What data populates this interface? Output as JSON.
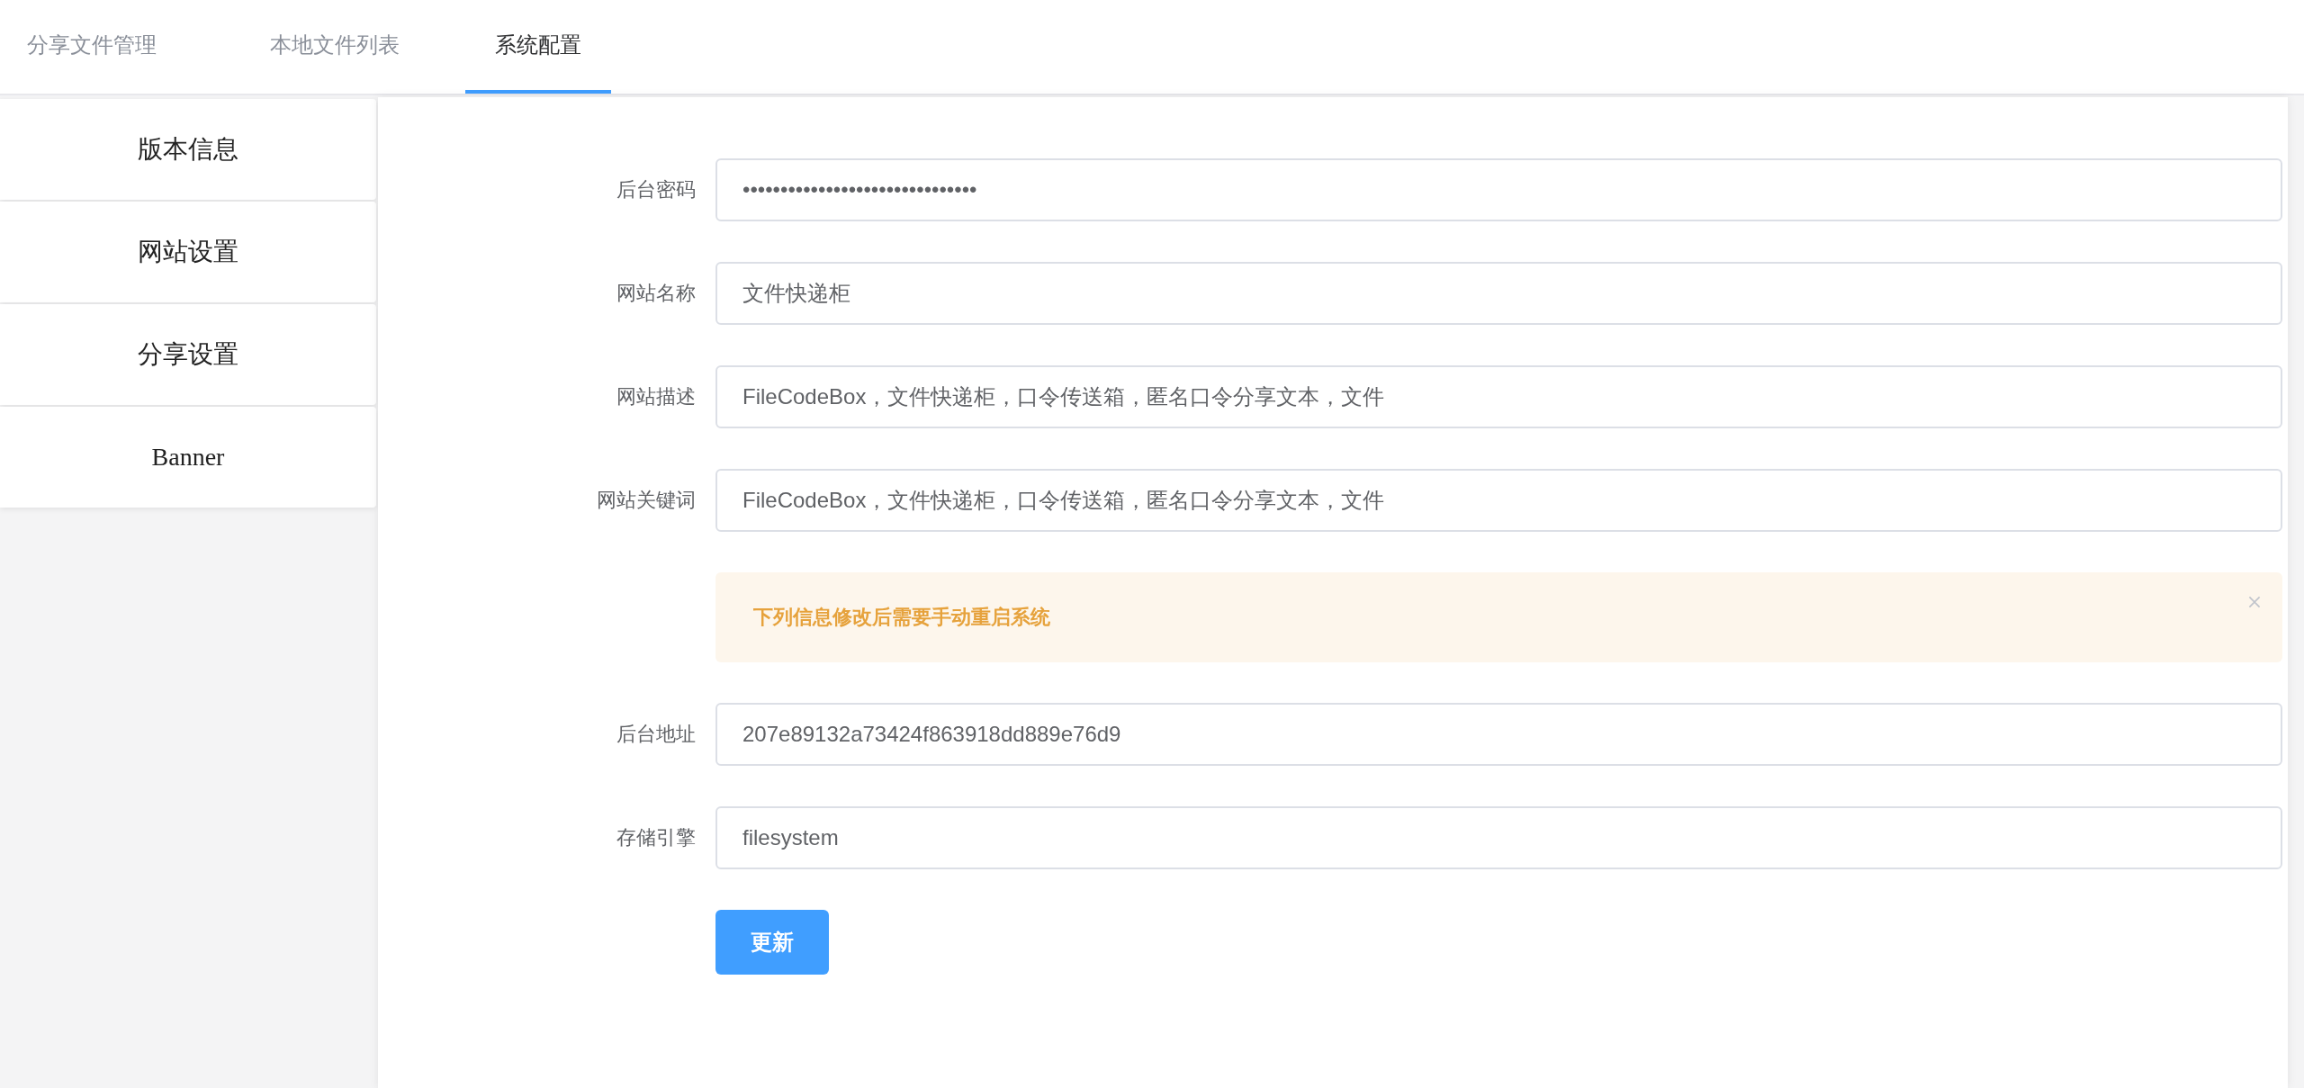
{
  "tabs": [
    {
      "label": "分享文件管理",
      "selected": false
    },
    {
      "label": "本地文件列表",
      "selected": false
    },
    {
      "label": "系统配置",
      "selected": true
    }
  ],
  "sidebar": {
    "items": [
      {
        "label": "版本信息"
      },
      {
        "label": "网站设置"
      },
      {
        "label": "分享设置"
      },
      {
        "label": "Banner"
      }
    ]
  },
  "form": {
    "fields": [
      {
        "kind": "field",
        "label": "后台密码",
        "value": "•••••••••••••••••••••••••••••••"
      },
      {
        "kind": "field",
        "label": "网站名称",
        "value": "文件快递柜"
      },
      {
        "kind": "field",
        "label": "网站描述",
        "value": "FileCodeBox，文件快递柜，口令传送箱，匿名口令分享文本，文件"
      },
      {
        "kind": "field",
        "label": "网站关键词",
        "value": "FileCodeBox，文件快递柜，口令传送箱，匿名口令分享文本，文件"
      },
      {
        "kind": "alert",
        "text": "下列信息修改后需要手动重启系统"
      },
      {
        "kind": "field",
        "label": "后台地址",
        "value": "207e89132a73424f863918dd889e76d9"
      },
      {
        "kind": "field",
        "label": "存储引擎",
        "value": "filesystem"
      }
    ],
    "submit": "更新"
  }
}
